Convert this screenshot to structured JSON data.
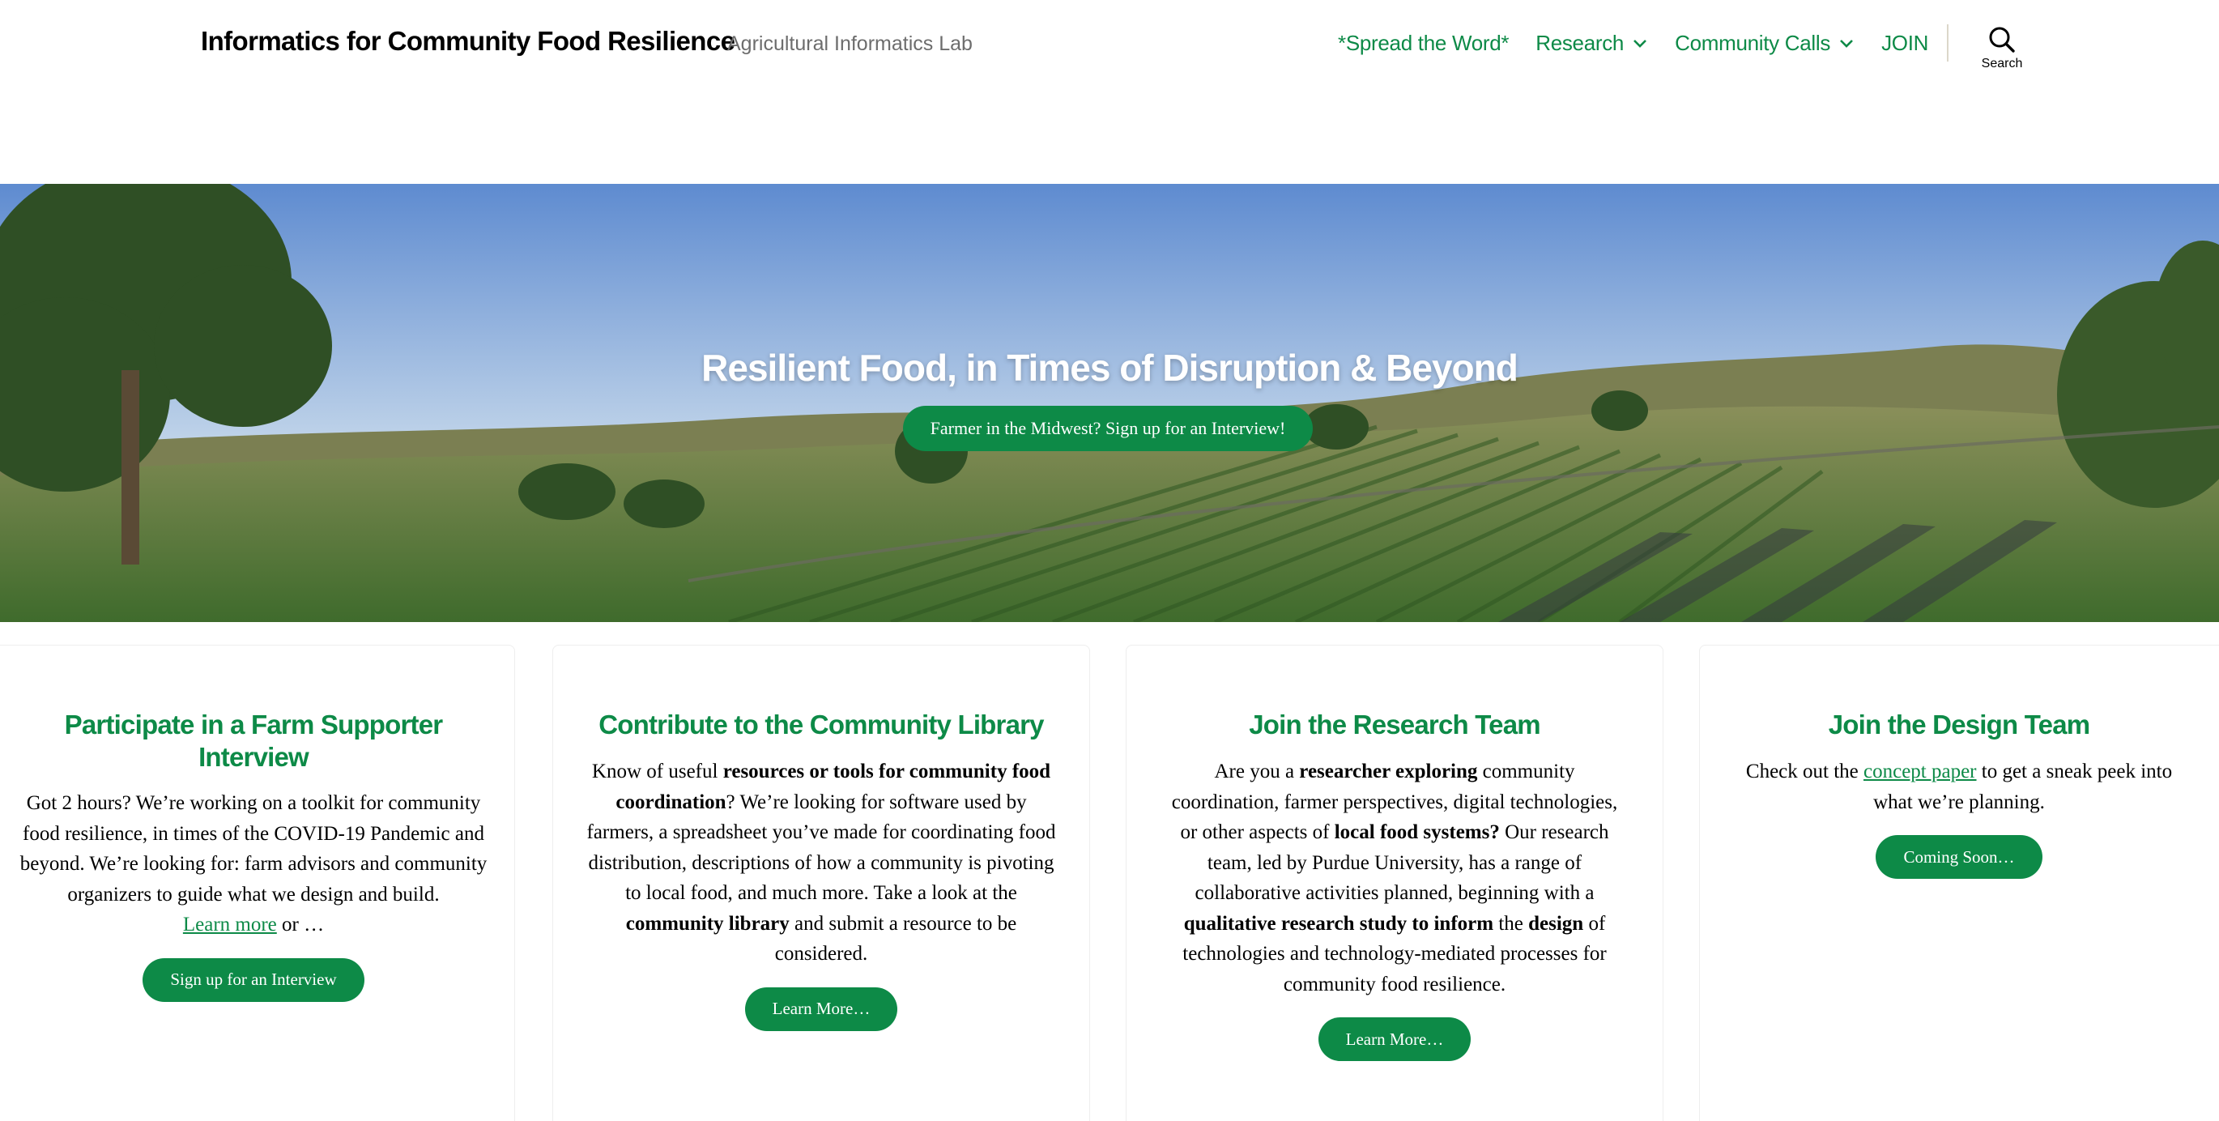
{
  "header": {
    "site_title": "Informatics for Community Food Resilience",
    "site_description": "Agricultural Informatics Lab",
    "nav": [
      {
        "label": "*Spread the Word*"
      },
      {
        "label": "Research"
      },
      {
        "label": "Community Calls"
      },
      {
        "label": "JOIN"
      }
    ],
    "search_label": "Search"
  },
  "hero": {
    "title": "Resilient Food, in Times of Disruption & Beyond",
    "button": "Farmer in the Midwest? Sign up for an Interview!"
  },
  "cards": [
    {
      "title": "Participate in a Farm Supporter Interview",
      "body": "Got 2 hours? We’re working on a toolkit for community food resilience, in times of the COVID-19 Pandemic and beyond. We’re looking for: farm advisors and community organizers to guide what we design and build.",
      "link": "Learn more",
      "after_link": " or …",
      "button": "Sign up for an Interview"
    },
    {
      "title": "Contribute to the Community Library",
      "body_1": "Know of useful ",
      "bold_1": "resources or tools for community food coordination",
      "body_2": "? We’re looking for software used by farmers, a spreadsheet you’ve made for coordinating food distribution, descriptions of how a community is pivoting to local food, and much more. Take a look at the ",
      "bold_2": "community library",
      "body_3": " and submit a resource to be considered.",
      "button": "Learn More…"
    },
    {
      "title": "Join the Research Team",
      "body_1": "Are you a ",
      "bold_1": "researcher exploring",
      "body_2": " community coordination, farmer perspectives, digital technologies, or other aspects of ",
      "bold_2": "local food systems?",
      "body_3": " Our research team, led by Purdue University, has a range of collaborative activities planned, beginning with a ",
      "bold_3": "qualitative research study to inform",
      "body_4": " the ",
      "bold_4": "design",
      "body_5": " of technologies and technology-mediated processes for community food resilience.",
      "button": "Learn More…"
    },
    {
      "title": "Join the Design Team",
      "body_1": "Check out the ",
      "link": "concept paper",
      "body_2": " to get a sneak peek into what we’re planning.",
      "button": "Coming Soon…"
    }
  ],
  "colors": {
    "accent": "#0d8a47",
    "text": "#000000",
    "muted": "#6d6d6d"
  }
}
